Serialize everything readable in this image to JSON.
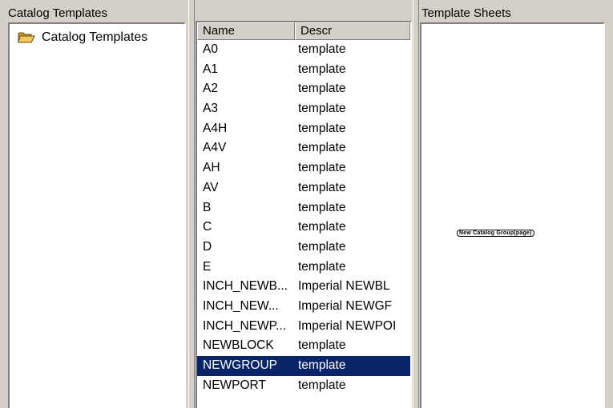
{
  "left_pane": {
    "header": "Catalog Templates",
    "tree": [
      {
        "label": "Catalog Templates",
        "icon": "open-folder-icon"
      }
    ]
  },
  "middle_pane": {
    "columns": [
      "Name",
      "Descr"
    ],
    "rows": [
      {
        "name": "A0",
        "descr": "template"
      },
      {
        "name": "A1",
        "descr": "template"
      },
      {
        "name": "A2",
        "descr": "template"
      },
      {
        "name": "A3",
        "descr": "template"
      },
      {
        "name": "A4H",
        "descr": "template"
      },
      {
        "name": "A4V",
        "descr": "template"
      },
      {
        "name": "AH",
        "descr": "template"
      },
      {
        "name": "AV",
        "descr": "template"
      },
      {
        "name": "B",
        "descr": "template"
      },
      {
        "name": "C",
        "descr": "template"
      },
      {
        "name": "D",
        "descr": "template"
      },
      {
        "name": "E",
        "descr": "template"
      },
      {
        "name": "INCH_NEWB...",
        "descr": "Imperial NEWBL"
      },
      {
        "name": "INCH_NEW...",
        "descr": "Imperial NEWGF"
      },
      {
        "name": "INCH_NEWP...",
        "descr": "Imperial NEWPOI"
      },
      {
        "name": "NEWBLOCK",
        "descr": "template"
      },
      {
        "name": "NEWGROUP",
        "descr": "template",
        "selected": true
      },
      {
        "name": "NEWPORT",
        "descr": "template"
      }
    ]
  },
  "right_pane": {
    "header": "Template Sheets",
    "preview_label": "New Catalog Group(page)"
  },
  "colors": {
    "window_bg": "#d4d0c8",
    "panel_bg": "#ffffff",
    "selection_bg": "#0a246a",
    "selection_fg": "#ffffff",
    "folder_yellow": "#e8c25a"
  }
}
